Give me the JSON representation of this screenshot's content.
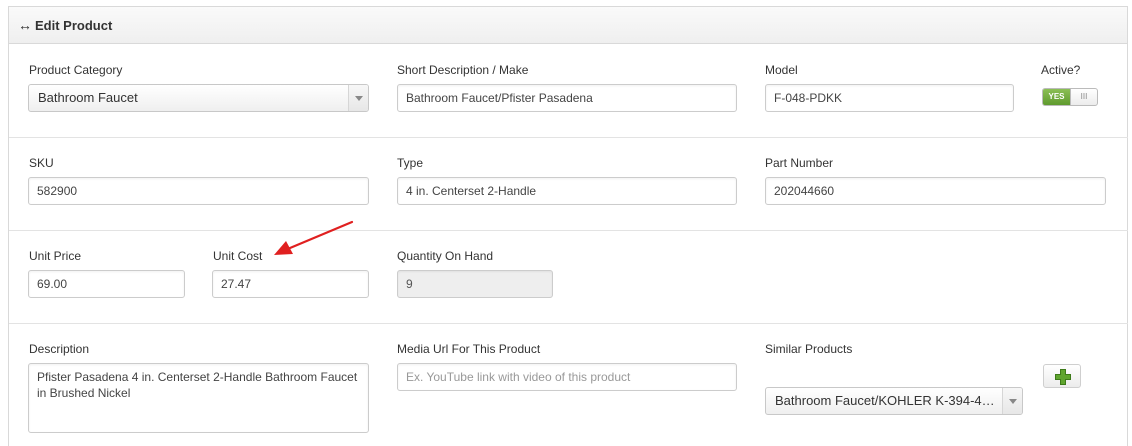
{
  "header": {
    "icon": "↔",
    "title": "Edit Product"
  },
  "row1": {
    "category_label": "Product Category",
    "category_value": "Bathroom Faucet",
    "short_desc_label": "Short Description / Make",
    "short_desc_value": "Bathroom Faucet/Pfister Pasadena",
    "model_label": "Model",
    "model_value": "F-048-PDKK",
    "active_label": "Active?",
    "active_on": "YES",
    "active_knob": "III"
  },
  "row2": {
    "sku_label": "SKU",
    "sku_value": "582900",
    "type_label": "Type",
    "type_value": "4 in. Centerset 2-Handle",
    "part_label": "Part Number",
    "part_value": "202044660"
  },
  "row3": {
    "price_label": "Unit Price",
    "price_value": "69.00",
    "cost_label": "Unit Cost",
    "cost_value": "27.47",
    "qty_label": "Quantity On Hand",
    "qty_value": "9"
  },
  "row4": {
    "desc_label": "Description",
    "desc_value": "Pfister Pasadena 4 in. Centerset 2-Handle Bathroom Faucet in Brushed Nickel",
    "media_label": "Media Url For This Product",
    "media_placeholder": "Ex. YouTube link with video of this product",
    "similar_label": "Similar Products",
    "similar_value": "Bathroom Faucet/KOHLER K-394-4…"
  },
  "colors": {
    "toggle_on": "#6ea83c",
    "annotation_arrow": "#e02020",
    "plus_icon": "#5fa52e"
  },
  "icons": {
    "header": "left-right-arrow-icon",
    "add": "plus-icon",
    "dropdown": "chevron-down-icon"
  }
}
